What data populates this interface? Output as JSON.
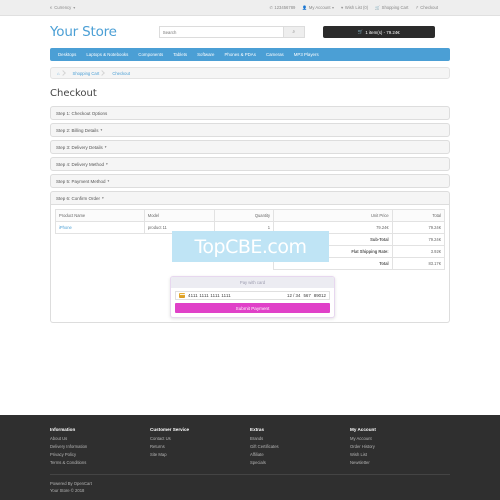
{
  "topbar": {
    "currency": {
      "label": "Currency",
      "symbol": "€",
      "caret": "▾"
    },
    "links": [
      {
        "icon": "phone-icon",
        "glyph": "✆",
        "label": "123456789"
      },
      {
        "icon": "user-icon",
        "glyph": "&#128100;",
        "label": "My Account",
        "caret": "▾"
      },
      {
        "icon": "heart-icon",
        "glyph": "♥",
        "label": "Wish List (0)"
      },
      {
        "icon": "cart-icon",
        "glyph": "&#128722;",
        "label": "Shopping Cart"
      },
      {
        "icon": "share-icon",
        "glyph": "↱",
        "label": "Checkout"
      }
    ]
  },
  "header": {
    "brand": "Your Store",
    "search_placeholder": "Search",
    "search_icon": "magnifier-icon",
    "search_glyph": "⌕",
    "cart_glyph": "&#128722;",
    "cart_label": "1 item(s) - 79.24€"
  },
  "nav": {
    "items": [
      "Desktops",
      "Laptops & Notebooks",
      "Components",
      "Tablets",
      "Software",
      "Phones & PDAs",
      "Cameras",
      "MP3 Players"
    ]
  },
  "breadcrumb": {
    "home_glyph": "⌂",
    "items": [
      "Shopping Cart",
      "Checkout"
    ]
  },
  "main": {
    "title": "Checkout",
    "steps": [
      {
        "label": "Step 1: Checkout Options",
        "caret": ""
      },
      {
        "label": "Step 2: Billing Details",
        "caret": "▾"
      },
      {
        "label": "Step 3: Delivery Details",
        "caret": "▾"
      },
      {
        "label": "Step 4: Delivery Method",
        "caret": "▾"
      },
      {
        "label": "Step 5: Payment Method",
        "caret": "▾"
      },
      {
        "label": "Step 6: Confirm Order",
        "caret": "▾"
      }
    ],
    "order_table": {
      "headers": [
        "Product Name",
        "Model",
        "Quantity",
        "Unit Price",
        "Total"
      ],
      "rows": [
        {
          "product": "iPhone",
          "model": "product 11",
          "quantity": "1",
          "unit_price": "79.24€",
          "total": "79.24€"
        }
      ],
      "totals": [
        {
          "label": "Sub-Total",
          "value": "79.24€"
        },
        {
          "label": "Flat Shipping Rate:",
          "value": "3.92€"
        },
        {
          "label": "Total",
          "value": "83.17€"
        }
      ]
    },
    "watermark": "TopCBE.com",
    "payment": {
      "title": "Pay with card",
      "card_icon": "credit-card-icon",
      "card_number": "4111 1111 1111 1111",
      "expiry": "12 / 34",
      "cvc": "567",
      "zip": "89012",
      "submit_label": "Submit Payment",
      "accent_color": "#e040c8"
    }
  },
  "footer": {
    "columns": [
      {
        "title": "Information",
        "links": [
          "About Us",
          "Delivery Information",
          "Privacy Policy",
          "Terms & Conditions"
        ]
      },
      {
        "title": "Customer Service",
        "links": [
          "Contact Us",
          "Returns",
          "Site Map"
        ]
      },
      {
        "title": "Extras",
        "links": [
          "Brands",
          "Gift Certificates",
          "Affiliate",
          "Specials"
        ]
      },
      {
        "title": "My Account",
        "links": [
          "My Account",
          "Order History",
          "Wish List",
          "Newsletter"
        ]
      }
    ],
    "powered_by": "Powered By OpenCart",
    "copyright": "Your Store © 2018"
  }
}
